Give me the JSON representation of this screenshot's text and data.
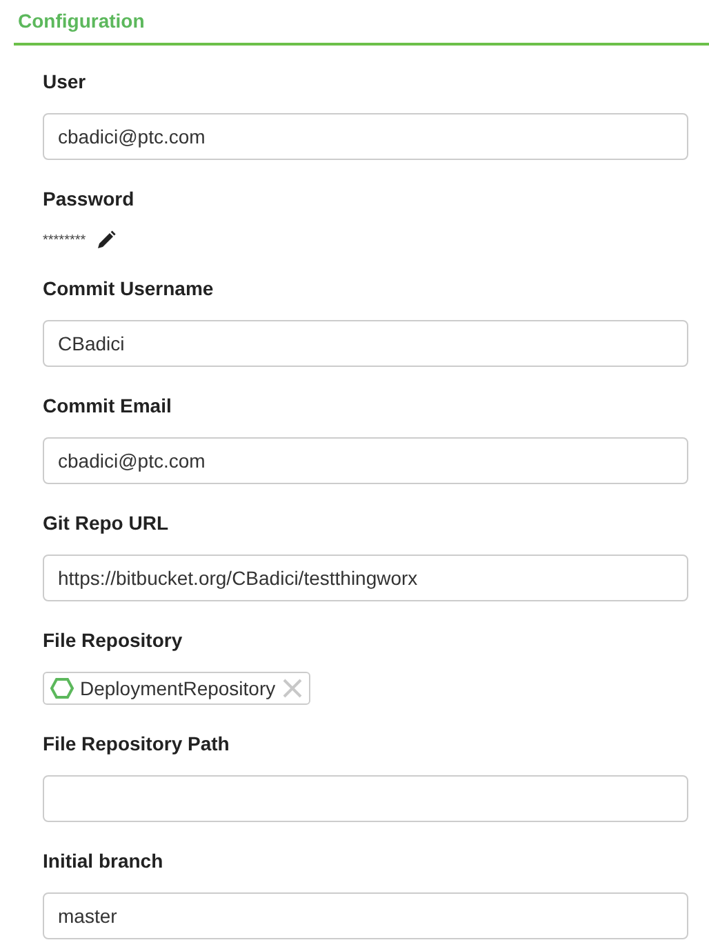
{
  "section": {
    "title": "Configuration"
  },
  "fields": [
    {
      "kind": "text",
      "label": "User",
      "value": "cbadici@ptc.com"
    },
    {
      "kind": "password",
      "label": "Password",
      "value": "********"
    },
    {
      "kind": "text",
      "label": "Commit Username",
      "value": "CBadici"
    },
    {
      "kind": "text",
      "label": "Commit Email",
      "value": "cbadici@ptc.com"
    },
    {
      "kind": "text",
      "label": "Git Repo URL",
      "value": "https://bitbucket.org/CBadici/testthingworx"
    },
    {
      "kind": "tag",
      "label": "File Repository",
      "value": "DeploymentRepository"
    },
    {
      "kind": "text",
      "label": "File Repository Path"
    },
    {
      "kind": "text",
      "label": "Initial branch",
      "value": "master"
    }
  ]
}
